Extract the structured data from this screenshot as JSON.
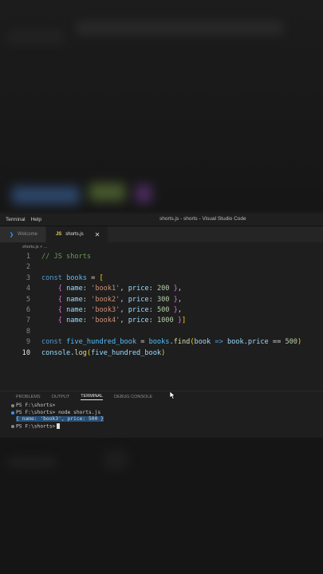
{
  "window": {
    "menu": [
      "Terminal",
      "Help"
    ],
    "title": "shorts.js - shorts - Visual Studio Code"
  },
  "tabs": [
    {
      "label": "Welcome",
      "icon": "vscode-icon",
      "active": false
    },
    {
      "label": "shorts.js",
      "icon": "js-icon",
      "active": true
    }
  ],
  "close_glyph": "✕",
  "breadcrumb": "shorts.js > ...",
  "code": {
    "line_numbers": [
      "1",
      "2",
      "3",
      "4",
      "5",
      "6",
      "7",
      "8",
      "9",
      "10"
    ],
    "l1": "// JS shorts",
    "l3": {
      "kw": "const",
      "name": "books",
      "eq": " = ",
      "br": "["
    },
    "rows": [
      {
        "name": "'book1'",
        "price": "200"
      },
      {
        "name": "'book2'",
        "price": "300"
      },
      {
        "name": "'book3'",
        "price": "500"
      },
      {
        "name": "'book4'",
        "price": "1000"
      }
    ],
    "row_keys": {
      "name": "name",
      "price": "price"
    },
    "l9": {
      "kw": "const",
      "name": "five_hundred_book",
      "arr": "books",
      "method": "find",
      "param": "book",
      "arrow": "=>",
      "obj": "book",
      "prop": "price",
      "op": "==",
      "val": "500"
    },
    "l10": {
      "obj": "console",
      "method": "log",
      "arg": "five_hundred_book"
    }
  },
  "panel": {
    "tabs": [
      "PROBLEMS",
      "OUTPUT",
      "TERMINAL",
      "DEBUG CONSOLE"
    ],
    "active_tab": "TERMINAL"
  },
  "terminal": {
    "prompt": "PS F:\\shorts>",
    "command": "node shorts.js",
    "output": "{ name: 'book3', price: 500 }"
  },
  "colors": {
    "dot_blue": "#3794ff",
    "dot_gray": "#888888"
  }
}
